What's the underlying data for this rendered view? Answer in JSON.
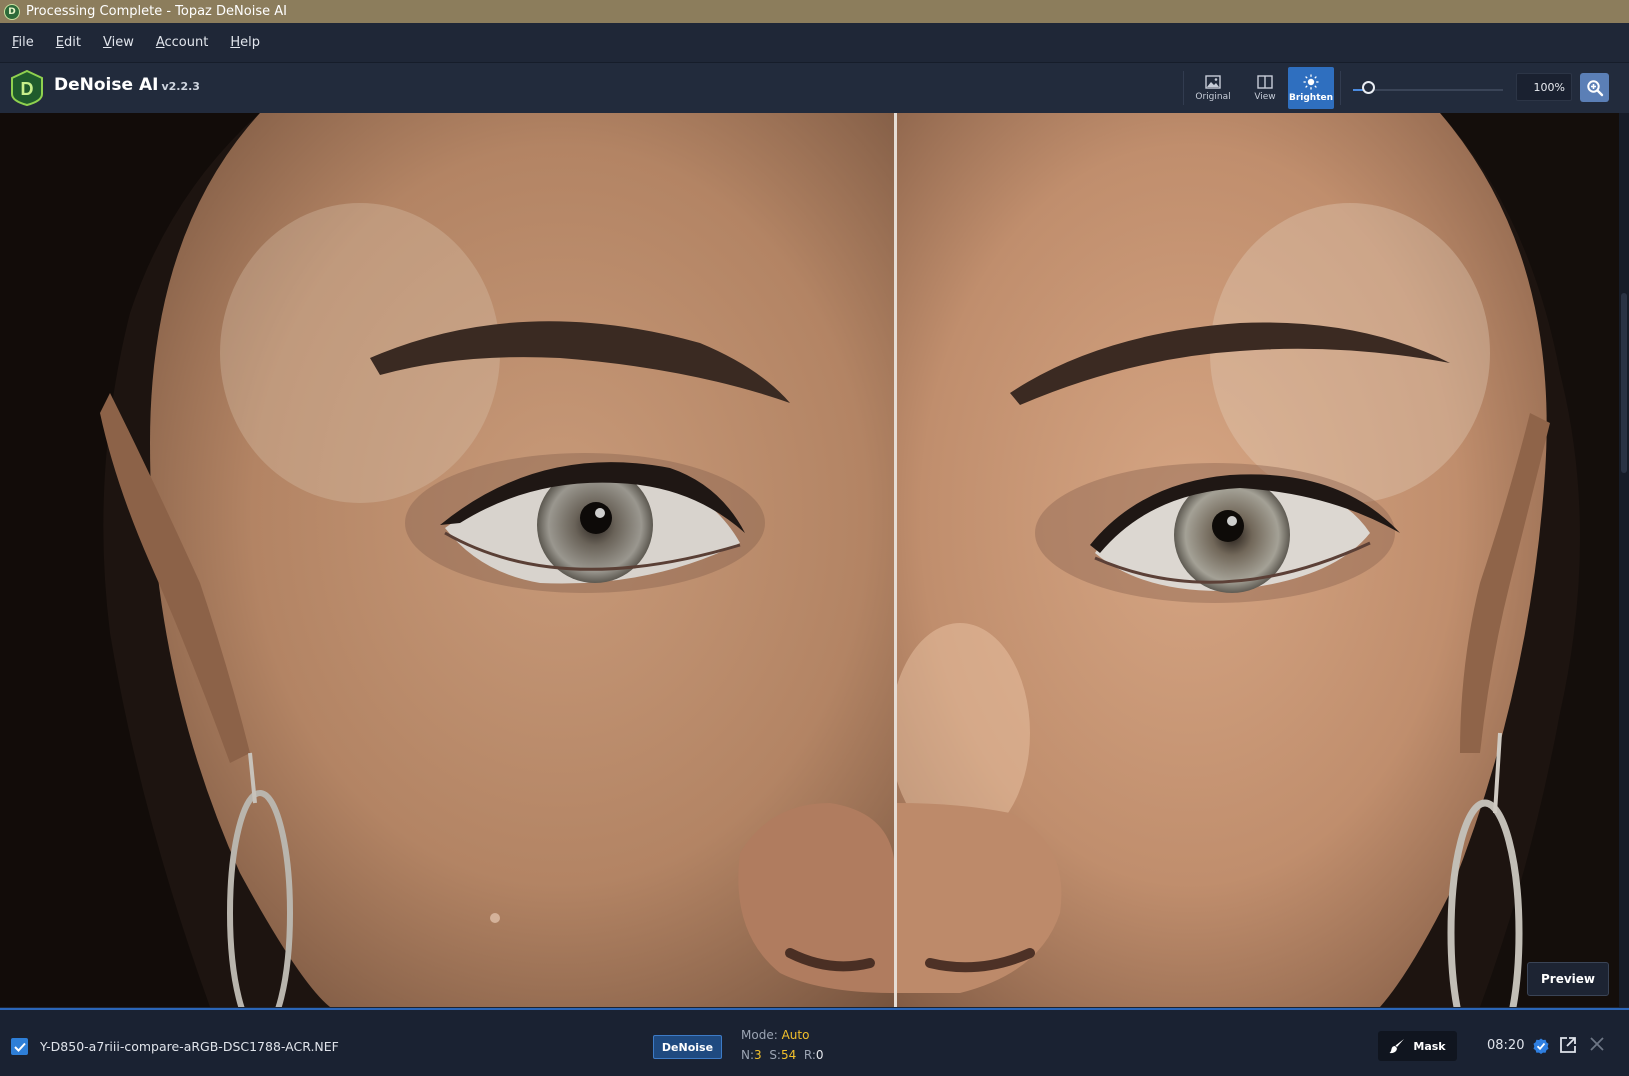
{
  "window": {
    "title": "Processing Complete - Topaz DeNoise AI"
  },
  "menu": [
    {
      "label": "File",
      "accel": "F",
      "rest": "ile"
    },
    {
      "label": "Edit",
      "accel": "E",
      "rest": "dit"
    },
    {
      "label": "View",
      "accel": "V",
      "rest": "iew"
    },
    {
      "label": "Account",
      "accel": "A",
      "rest": "ccount"
    },
    {
      "label": "Help",
      "accel": "H",
      "rest": "elp"
    }
  ],
  "header": {
    "app_name": "DeNoise AI",
    "version": "v2.2.3",
    "tools": {
      "original": "Original",
      "view": "View",
      "brighten": "Brighten"
    },
    "zoom_level": "100%",
    "zoom_slider_value": 0.1
  },
  "viewport": {
    "preview_label": "Preview",
    "comparison": "split view: original (left) / processed (right)"
  },
  "file": {
    "name": "Y-D850-a7riii-compare-aRGB-DSC1788-ACR.NEF",
    "process_badge": "DeNoise",
    "mode_label": "Mode:",
    "mode_value": "Auto",
    "n_label": "N:",
    "n_value": "3",
    "s_label": "S:",
    "s_value": "54",
    "r_label": "R:",
    "r_value": "0",
    "mask_label": "Mask",
    "time": "08:20"
  },
  "colors": {
    "accent": "#2f6fbf",
    "titlebar": "#8c7d5c",
    "highlight_value": "#f2c02b"
  }
}
